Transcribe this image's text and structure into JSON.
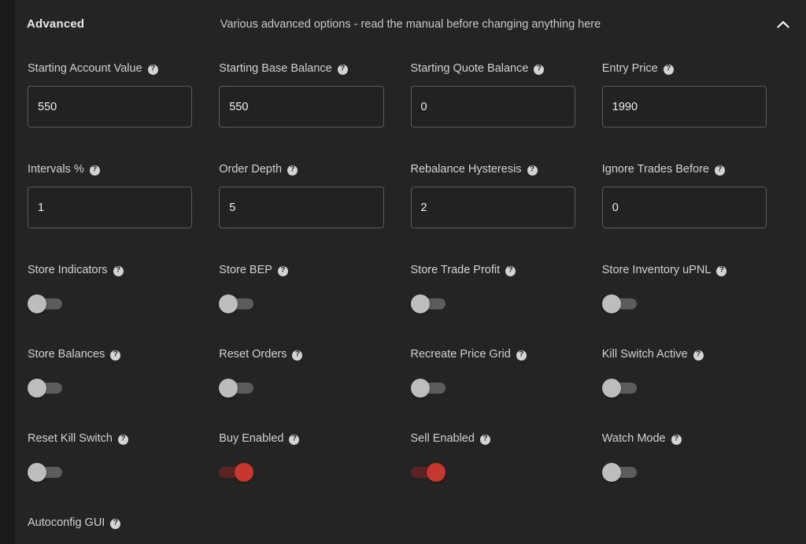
{
  "panel": {
    "title": "Advanced",
    "subtitle": "Various advanced options - read the manual before changing anything here",
    "collapse_icon": "chevron-up-icon",
    "help_icon_glyph": "?",
    "colors": {
      "page_background": "#1a1a1a",
      "card_background": "#242424",
      "input_background": "#222222",
      "input_border": "#5b5b5b",
      "label_text": "#d2d2d2",
      "toggle_off_track": "#5c5c5c",
      "toggle_off_knob": "#bdbdbd",
      "toggle_on_track": "#5c2321",
      "toggle_on_knob": "#c8372f"
    }
  },
  "rows": [
    {
      "kind": "input",
      "fields": [
        {
          "label": "Starting Account Value",
          "value": "550",
          "help": "?"
        },
        {
          "label": "Starting Base Balance",
          "value": "550",
          "help": "?"
        },
        {
          "label": "Starting Quote Balance",
          "value": "0",
          "help": "?"
        },
        {
          "label": "Entry Price",
          "value": "1990",
          "help": "?"
        }
      ]
    },
    {
      "kind": "input",
      "fields": [
        {
          "label": "Intervals %",
          "value": "1",
          "help": "?"
        },
        {
          "label": "Order Depth",
          "value": "5",
          "help": "?"
        },
        {
          "label": "Rebalance Hysteresis",
          "value": "2",
          "help": "?"
        },
        {
          "label": "Ignore Trades Before",
          "value": "0",
          "help": "?"
        }
      ]
    },
    {
      "kind": "toggle",
      "fields": [
        {
          "label": "Store Indicators",
          "state": "off",
          "help": "?"
        },
        {
          "label": "Store BEP",
          "state": "off",
          "help": "?"
        },
        {
          "label": "Store Trade Profit",
          "state": "off",
          "help": "?"
        },
        {
          "label": "Store Inventory uPNL",
          "state": "off",
          "help": "?"
        }
      ]
    },
    {
      "kind": "toggle",
      "fields": [
        {
          "label": "Store Balances",
          "state": "off",
          "help": "?"
        },
        {
          "label": "Reset Orders",
          "state": "off",
          "help": "?"
        },
        {
          "label": "Recreate Price Grid",
          "state": "off",
          "help": "?"
        },
        {
          "label": "Kill Switch Active",
          "state": "off",
          "help": "?"
        }
      ]
    },
    {
      "kind": "toggle",
      "fields": [
        {
          "label": "Reset Kill Switch",
          "state": "off",
          "help": "?"
        },
        {
          "label": "Buy Enabled",
          "state": "on",
          "help": "?"
        },
        {
          "label": "Sell Enabled",
          "state": "on",
          "help": "?"
        },
        {
          "label": "Watch Mode",
          "state": "off",
          "help": "?"
        }
      ]
    },
    {
      "kind": "last",
      "fields": [
        {
          "label": "Autoconfig GUI",
          "help": "?"
        }
      ]
    }
  ]
}
